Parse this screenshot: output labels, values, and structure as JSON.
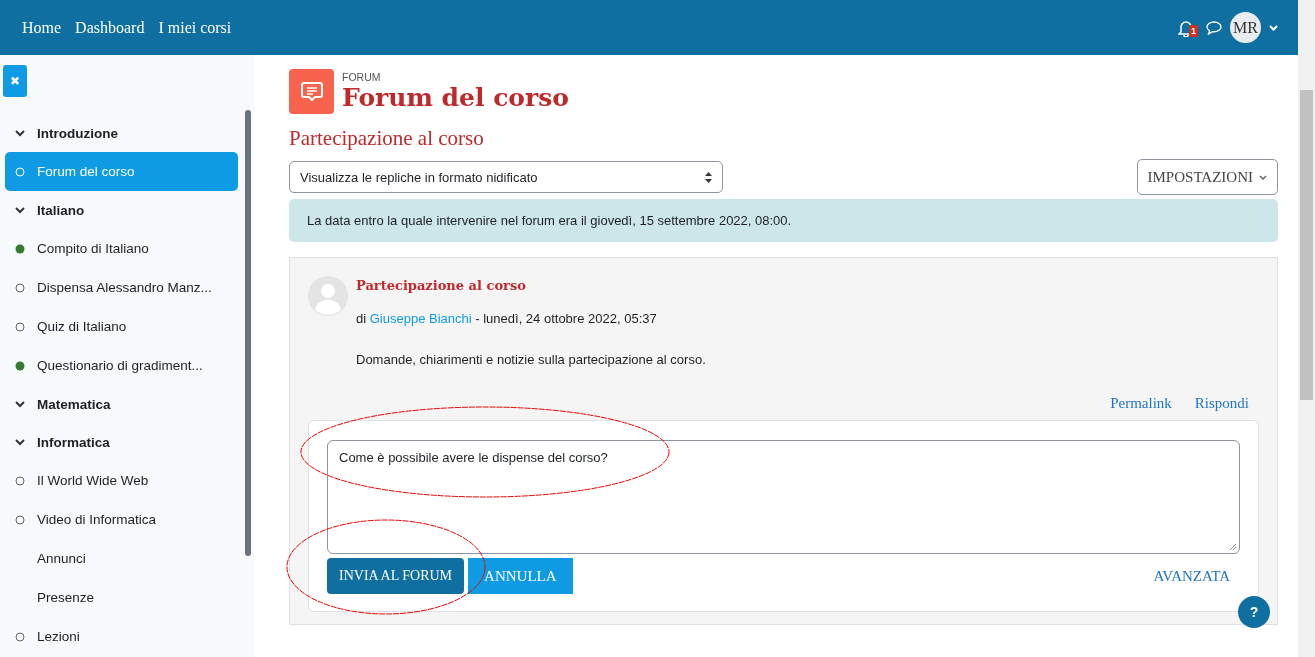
{
  "navbar": {
    "links": [
      "Home",
      "Dashboard",
      "I miei corsi"
    ],
    "notification_count": "1",
    "avatar_initials": "MR"
  },
  "sidebar": {
    "close_label": "✖",
    "items": [
      {
        "kind": "section",
        "label": "Introduzione",
        "selected": false
      },
      {
        "kind": "activity",
        "label": "Forum del corso",
        "completed": false,
        "selected": true
      },
      {
        "kind": "section",
        "label": "Italiano",
        "selected": false
      },
      {
        "kind": "activity",
        "label": "Compito di Italiano",
        "completed": true,
        "selected": false
      },
      {
        "kind": "activity",
        "label": "Dispensa Alessandro Manz...",
        "completed": false,
        "selected": false
      },
      {
        "kind": "activity",
        "label": "Quiz di Italiano",
        "completed": false,
        "selected": false
      },
      {
        "kind": "activity",
        "label": "Questionario di gradiment...",
        "completed": true,
        "selected": false
      },
      {
        "kind": "section",
        "label": "Matematica",
        "selected": false
      },
      {
        "kind": "section",
        "label": "Informatica",
        "selected": false
      },
      {
        "kind": "activity",
        "label": "Il World Wide Web",
        "completed": false,
        "selected": false
      },
      {
        "kind": "activity",
        "label": "Video di Informatica",
        "completed": false,
        "selected": false
      },
      {
        "kind": "link",
        "label": "Annunci",
        "selected": false
      },
      {
        "kind": "link",
        "label": "Presenze",
        "selected": false
      },
      {
        "kind": "activity",
        "label": "Lezioni",
        "completed": false,
        "selected": false
      }
    ]
  },
  "page": {
    "module_label": "FORUM",
    "title": "Forum del corso",
    "discussion_title": "Partecipazione al corso",
    "display_mode": {
      "value": "Visualizza le repliche in formato nidificato"
    },
    "settings_button": "IMPOSTAZIONI",
    "notice": "La data entro la quale intervenire nel forum era il giovedì, 15 settembre 2022, 08:00.",
    "post": {
      "subject": "Partecipazione al corso",
      "by": "di",
      "author": "Giuseppe Bianchi",
      "date": "- lunedì, 24 ottobre 2022, 05:37",
      "body": "Domande, chiarimenti e notizie sulla partecipazione al corso.",
      "actions": [
        "Permalink",
        "Rispondi"
      ]
    },
    "reply": {
      "value": "Come è possibile avere le dispense del corso?",
      "submit": "INVIA AL FORUM",
      "cancel": "ANNULLA",
      "advanced": "AVANZATA"
    }
  },
  "help_button": "?"
}
